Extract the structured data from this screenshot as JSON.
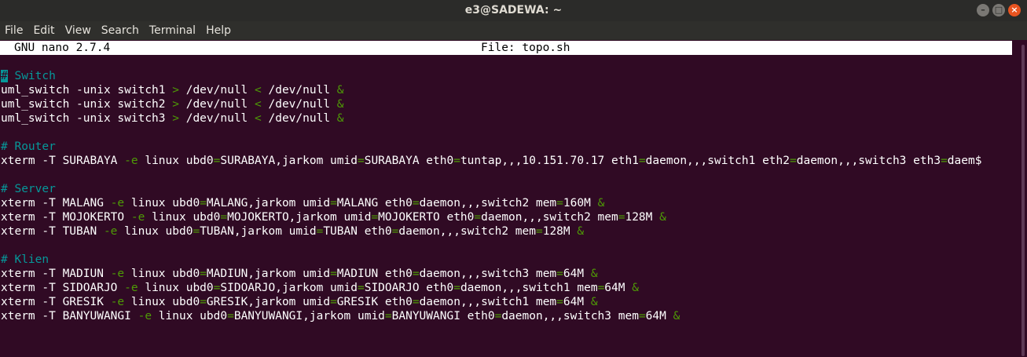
{
  "window": {
    "title": "e3@SADEWA: ~",
    "controls": [
      "minimize-icon",
      "maximize-icon",
      "close-icon"
    ]
  },
  "menu": [
    "File",
    "Edit",
    "View",
    "Search",
    "Terminal",
    "Help"
  ],
  "nano": {
    "version": "GNU nano 2.7.4",
    "file": "File: topo.sh"
  },
  "colors": {
    "background": "#300a24",
    "comment": "#06989a",
    "operator": "#4e9a06",
    "text": "#ffffff"
  },
  "lines": [
    [
      {
        "t": "#",
        "c": "cursor"
      },
      {
        "t": " Switch",
        "c": "comment"
      }
    ],
    [
      {
        "t": "uml_switch -unix switch1 "
      },
      {
        "t": ">",
        "c": "op"
      },
      {
        "t": " /dev/null "
      },
      {
        "t": "<",
        "c": "op"
      },
      {
        "t": " /dev/null "
      },
      {
        "t": "&",
        "c": "op"
      }
    ],
    [
      {
        "t": "uml_switch -unix switch2 "
      },
      {
        "t": ">",
        "c": "op"
      },
      {
        "t": " /dev/null "
      },
      {
        "t": "<",
        "c": "op"
      },
      {
        "t": " /dev/null "
      },
      {
        "t": "&",
        "c": "op"
      }
    ],
    [
      {
        "t": "uml_switch -unix switch3 "
      },
      {
        "t": ">",
        "c": "op"
      },
      {
        "t": " /dev/null "
      },
      {
        "t": "<",
        "c": "op"
      },
      {
        "t": " /dev/null "
      },
      {
        "t": "&",
        "c": "op"
      }
    ],
    [],
    [
      {
        "t": "# Router",
        "c": "comment"
      }
    ],
    [
      {
        "t": "xterm -T SURABAYA "
      },
      {
        "t": "-e",
        "c": "op"
      },
      {
        "t": " linux ubd0"
      },
      {
        "t": "=",
        "c": "op"
      },
      {
        "t": "SURABAYA,jarkom umid"
      },
      {
        "t": "=",
        "c": "op"
      },
      {
        "t": "SURABAYA eth0"
      },
      {
        "t": "=",
        "c": "op"
      },
      {
        "t": "tuntap,,,10.151.70.17 eth1"
      },
      {
        "t": "=",
        "c": "op"
      },
      {
        "t": "daemon,,,switch1 eth2"
      },
      {
        "t": "=",
        "c": "op"
      },
      {
        "t": "daemon,,,switch3 eth3"
      },
      {
        "t": "=",
        "c": "op"
      },
      {
        "t": "daem$"
      }
    ],
    [],
    [
      {
        "t": "# Server",
        "c": "comment"
      }
    ],
    [
      {
        "t": "xterm -T MALANG "
      },
      {
        "t": "-e",
        "c": "op"
      },
      {
        "t": " linux ubd0"
      },
      {
        "t": "=",
        "c": "op"
      },
      {
        "t": "MALANG,jarkom umid"
      },
      {
        "t": "=",
        "c": "op"
      },
      {
        "t": "MALANG eth0"
      },
      {
        "t": "=",
        "c": "op"
      },
      {
        "t": "daemon,,,switch2 mem"
      },
      {
        "t": "=",
        "c": "op"
      },
      {
        "t": "160M "
      },
      {
        "t": "&",
        "c": "op"
      }
    ],
    [
      {
        "t": "xterm -T MOJOKERTO "
      },
      {
        "t": "-e",
        "c": "op"
      },
      {
        "t": " linux ubd0"
      },
      {
        "t": "=",
        "c": "op"
      },
      {
        "t": "MOJOKERTO,jarkom umid"
      },
      {
        "t": "=",
        "c": "op"
      },
      {
        "t": "MOJOKERTO eth0"
      },
      {
        "t": "=",
        "c": "op"
      },
      {
        "t": "daemon,,,switch2 mem"
      },
      {
        "t": "=",
        "c": "op"
      },
      {
        "t": "128M "
      },
      {
        "t": "&",
        "c": "op"
      }
    ],
    [
      {
        "t": "xterm -T TUBAN "
      },
      {
        "t": "-e",
        "c": "op"
      },
      {
        "t": " linux ubd0"
      },
      {
        "t": "=",
        "c": "op"
      },
      {
        "t": "TUBAN,jarkom umid"
      },
      {
        "t": "=",
        "c": "op"
      },
      {
        "t": "TUBAN eth0"
      },
      {
        "t": "=",
        "c": "op"
      },
      {
        "t": "daemon,,,switch2 mem"
      },
      {
        "t": "=",
        "c": "op"
      },
      {
        "t": "128M "
      },
      {
        "t": "&",
        "c": "op"
      }
    ],
    [],
    [
      {
        "t": "# Klien",
        "c": "comment"
      }
    ],
    [
      {
        "t": "xterm -T MADIUN "
      },
      {
        "t": "-e",
        "c": "op"
      },
      {
        "t": " linux ubd0"
      },
      {
        "t": "=",
        "c": "op"
      },
      {
        "t": "MADIUN,jarkom umid"
      },
      {
        "t": "=",
        "c": "op"
      },
      {
        "t": "MADIUN eth0"
      },
      {
        "t": "=",
        "c": "op"
      },
      {
        "t": "daemon,,,switch3 mem"
      },
      {
        "t": "=",
        "c": "op"
      },
      {
        "t": "64M "
      },
      {
        "t": "&",
        "c": "op"
      }
    ],
    [
      {
        "t": "xterm -T SIDOARJO "
      },
      {
        "t": "-e",
        "c": "op"
      },
      {
        "t": " linux ubd0"
      },
      {
        "t": "=",
        "c": "op"
      },
      {
        "t": "SIDOARJO,jarkom umid"
      },
      {
        "t": "=",
        "c": "op"
      },
      {
        "t": "SIDOARJO eth0"
      },
      {
        "t": "=",
        "c": "op"
      },
      {
        "t": "daemon,,,switch1 mem"
      },
      {
        "t": "=",
        "c": "op"
      },
      {
        "t": "64M "
      },
      {
        "t": "&",
        "c": "op"
      }
    ],
    [
      {
        "t": "xterm -T GRESIK "
      },
      {
        "t": "-e",
        "c": "op"
      },
      {
        "t": " linux ubd0"
      },
      {
        "t": "=",
        "c": "op"
      },
      {
        "t": "GRESIK,jarkom umid"
      },
      {
        "t": "=",
        "c": "op"
      },
      {
        "t": "GRESIK eth0"
      },
      {
        "t": "=",
        "c": "op"
      },
      {
        "t": "daemon,,,switch1 mem"
      },
      {
        "t": "=",
        "c": "op"
      },
      {
        "t": "64M "
      },
      {
        "t": "&",
        "c": "op"
      }
    ],
    [
      {
        "t": "xterm -T BANYUWANGI "
      },
      {
        "t": "-e",
        "c": "op"
      },
      {
        "t": " linux ubd0"
      },
      {
        "t": "=",
        "c": "op"
      },
      {
        "t": "BANYUWANGI,jarkom umid"
      },
      {
        "t": "=",
        "c": "op"
      },
      {
        "t": "BANYUWANGI eth0"
      },
      {
        "t": "=",
        "c": "op"
      },
      {
        "t": "daemon,,,switch3 mem"
      },
      {
        "t": "=",
        "c": "op"
      },
      {
        "t": "64M "
      },
      {
        "t": "&",
        "c": "op"
      }
    ]
  ]
}
